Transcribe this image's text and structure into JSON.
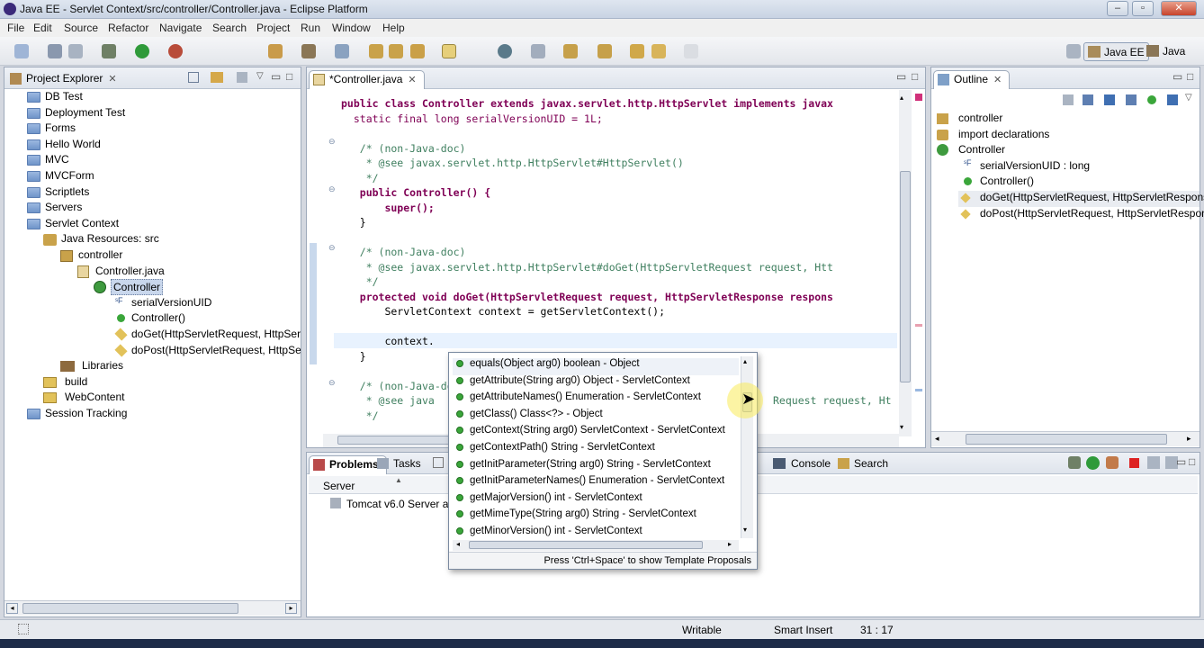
{
  "window": {
    "title": "Java EE - Servlet Context/src/controller/Controller.java - Eclipse Platform"
  },
  "menu": [
    "File",
    "Edit",
    "Source",
    "Refactor",
    "Navigate",
    "Search",
    "Project",
    "Run",
    "Window",
    "Help"
  ],
  "perspectives": {
    "java_ee": "Java EE",
    "java": "Java"
  },
  "project_explorer": {
    "title": "Project Explorer",
    "items": [
      {
        "label": "DB Test"
      },
      {
        "label": "Deployment Test"
      },
      {
        "label": "Forms"
      },
      {
        "label": "Hello World"
      },
      {
        "label": "MVC"
      },
      {
        "label": "MVCForm"
      },
      {
        "label": "Scriptlets"
      },
      {
        "label": "Servers"
      },
      {
        "label": "Servlet Context"
      },
      {
        "label": "Java Resources: src"
      },
      {
        "label": "controller"
      },
      {
        "label": "Controller.java"
      },
      {
        "label": "Controller"
      },
      {
        "label": "serialVersionUID"
      },
      {
        "label": "Controller()"
      },
      {
        "label": "doGet(HttpServletRequest, HttpServle"
      },
      {
        "label": "doPost(HttpServletRequest, HttpServ"
      },
      {
        "label": "Libraries"
      },
      {
        "label": "build"
      },
      {
        "label": "WebContent"
      },
      {
        "label": "Session Tracking"
      }
    ]
  },
  "editor": {
    "tab": "*Controller.java",
    "lines": [
      "public class Controller extends javax.servlet.http.HttpServlet implements javax",
      "  static final long serialVersionUID = 1L;",
      "",
      "   /* (non-Java-doc)",
      "    * @see javax.servlet.http.HttpServlet#HttpServlet()",
      "    */",
      "   public Controller() {",
      "       super();",
      "   }",
      "",
      "   /* (non-Java-doc)",
      "    * @see javax.servlet.http.HttpServlet#doGet(HttpServletRequest request, Htt",
      "    */",
      "   protected void doGet(HttpServletRequest request, HttpServletResponse respons",
      "       ServletContext context = getServletContext();",
      "",
      "       context.",
      "   }",
      "",
      "   /* (non-Java-doc)",
      "    * @see java",
      "    */"
    ],
    "obscured_tail": "Request request, Ht"
  },
  "outline": {
    "title": "Outline",
    "items": [
      {
        "label": "controller"
      },
      {
        "label": "import declarations"
      },
      {
        "label": "Controller"
      },
      {
        "label": "serialVersionUID : long"
      },
      {
        "label": "Controller()"
      },
      {
        "label": "doGet(HttpServletRequest, HttpServletRespons"
      },
      {
        "label": "doPost(HttpServletRequest, HttpServletRespon"
      }
    ]
  },
  "bottom": {
    "tabs": [
      "Problems",
      "Tasks",
      "Console",
      "Search"
    ],
    "column": "Server",
    "row": "Tomcat v6.0 Server at"
  },
  "autocomplete": {
    "items": [
      "equals(Object arg0)  boolean - Object",
      "getAttribute(String arg0)  Object - ServletContext",
      "getAttributeNames()  Enumeration - ServletContext",
      "getClass()  Class<?> - Object",
      "getContext(String arg0)  ServletContext - ServletContext",
      "getContextPath()  String - ServletContext",
      "getInitParameter(String arg0)  String - ServletContext",
      "getInitParameterNames()  Enumeration - ServletContext",
      "getMajorVersion()  int - ServletContext",
      "getMimeType(String arg0)  String - ServletContext",
      "getMinorVersion()  int - ServletContext"
    ],
    "footer": "Press 'Ctrl+Space' to show Template Proposals"
  },
  "status": {
    "writable": "Writable",
    "insert": "Smart Insert",
    "position": "31 : 17"
  },
  "colors": {
    "keyword": "#7f0055",
    "comment": "#3f7f5f",
    "field": "#0000c0",
    "method_icon": "#3aa63a"
  }
}
